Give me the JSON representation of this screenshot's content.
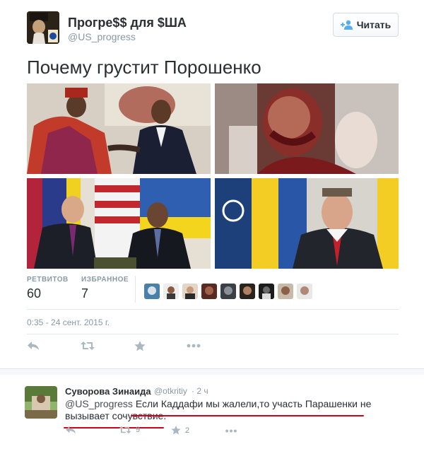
{
  "tweet": {
    "display_name": "Прогре$$ для $ША",
    "handle": "@US_progress",
    "follow_label": "Читать",
    "text": "Почему грустит Порошенко",
    "stats": {
      "retweets_label": "РЕТВИТОВ",
      "retweets_value": "60",
      "favorites_label": "ИЗБРАННОЕ",
      "favorites_value": "7"
    },
    "timestamp": "0:35 - 24 сент. 2015 г."
  },
  "reply": {
    "name": "Суворова Зинаида",
    "handle": "@otkritiy",
    "time": "· 2 ч",
    "mention": "@US_progress",
    "text": "Если Каддафи мы жалели,то участь Парашенки не вызывает сочувствие.",
    "retweets": "9",
    "favorites": "2"
  },
  "colors": {
    "muted": "#8899a6",
    "text": "#292f33",
    "border": "#e1e8ed",
    "highlight": "#d0021b"
  },
  "icons": [
    "follow-person-icon",
    "reply-icon",
    "retweet-icon",
    "favorite-star-icon",
    "more-dots-icon"
  ]
}
